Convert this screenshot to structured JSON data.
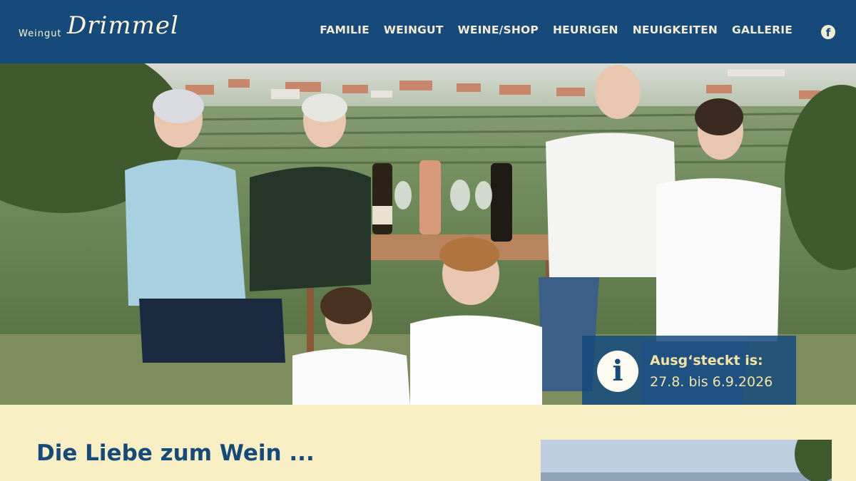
{
  "brand": {
    "prefix": "Weingut",
    "name": "Drimmel"
  },
  "nav": {
    "items": [
      {
        "label": "FAMILIE"
      },
      {
        "label": "WEINGUT"
      },
      {
        "label": "WEINE/SHOP"
      },
      {
        "label": "HEURIGEN"
      },
      {
        "label": "NEUIGKEITEN"
      },
      {
        "label": "GALLERIE"
      }
    ],
    "social_icon": "facebook-icon"
  },
  "notice": {
    "icon": "info-icon",
    "title": "Ausg‘steckt is:",
    "dates": "27.8. bis 6.9.2026"
  },
  "content": {
    "heading": "Die Liebe zum Wein ..."
  },
  "colors": {
    "header": "#154a7b",
    "background": "#f8efc4",
    "accent": "#f4e4a4"
  }
}
